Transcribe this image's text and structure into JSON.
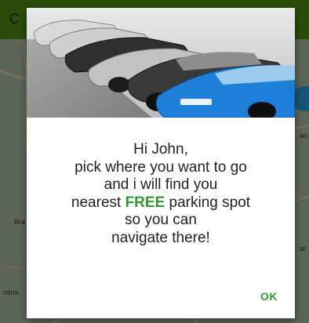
{
  "app": {
    "title_initial": "C",
    "map_labels": [
      "Bra",
      "ntina",
      "an",
      "ar"
    ]
  },
  "dialog": {
    "greeting": "Hi John,",
    "line1": "pick where you want to go",
    "line2": "and i will find you",
    "line3_before": "nearest ",
    "line3_free": "FREE",
    "line3_after": " parking spot",
    "line4": "so you can",
    "line5": "navigate there!",
    "ok_label": "OK"
  },
  "colors": {
    "accent_green": "#2e9a2f",
    "topbar": "#4d8a14",
    "blue_car": "#1d7fd8"
  }
}
